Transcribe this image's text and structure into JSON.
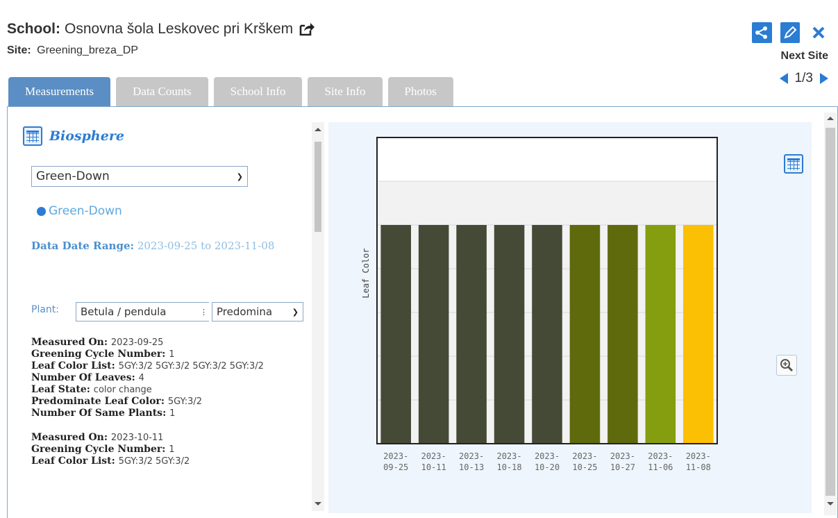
{
  "header": {
    "school_label": "School:",
    "school_name": "Osnovna šola Leskovec pri Krškem",
    "site_label": "Site:",
    "site_name": "Greening_breza_DP"
  },
  "nav": {
    "next_site": "Next Site",
    "page": "1/3"
  },
  "tabs": [
    {
      "label": "Measurements",
      "active": true
    },
    {
      "label": "Data Counts",
      "active": false
    },
    {
      "label": "School Info",
      "active": false
    },
    {
      "label": "Site Info",
      "active": false
    },
    {
      "label": "Photos",
      "active": false
    }
  ],
  "left": {
    "section_title": "Biosphere",
    "protocol_select": "Green-Down",
    "radio_label": "Green-Down",
    "date_range_label": "Data Date Range:",
    "date_range_value": "2023-09-25 to 2023-11-08",
    "plant_label": "Plant:",
    "plant_select": "Betula / pendula",
    "color_select": "Predomina"
  },
  "records": [
    {
      "measured_on_k": "Measured On",
      "measured_on_v": "2023-09-25",
      "cycle_k": "Greening Cycle Number",
      "cycle_v": "1",
      "list_k": "Leaf Color List",
      "list_v": "5GY:3/2 5GY:3/2 5GY:3/2 5GY:3/2",
      "leaves_k": "Number Of Leaves",
      "leaves_v": "4",
      "state_k": "Leaf State",
      "state_v": "color change",
      "pred_k": "Predominate Leaf Color",
      "pred_v": "5GY:3/2",
      "same_k": "Number Of Same Plants",
      "same_v": "1"
    },
    {
      "measured_on_k": "Measured On",
      "measured_on_v": "2023-10-11",
      "cycle_k": "Greening Cycle Number",
      "cycle_v": "1",
      "list_k": "Leaf Color List",
      "list_v": "5GY:3/2 5GY:3/2"
    }
  ],
  "colors": {
    "accent": "#2b7cd3",
    "tab_active": "#5b8ec4",
    "tab_inactive": "#c7c7c7"
  },
  "icons": {
    "external": "external-link-icon",
    "share": "share-icon",
    "edit": "edit-pencil-icon",
    "close": "close-x-icon",
    "table": "table-icon",
    "zoom": "zoom-in-icon"
  },
  "chart_data": {
    "type": "bar",
    "ylabel": "Leaf Color",
    "categories": [
      [
        "2023-",
        "09-25"
      ],
      [
        "2023-",
        "10-11"
      ],
      [
        "2023-",
        "10-13"
      ],
      [
        "2023-",
        "10-18"
      ],
      [
        "2023-",
        "10-20"
      ],
      [
        "2023-",
        "10-25"
      ],
      [
        "2023-",
        "10-27"
      ],
      [
        "2023-",
        "11-06"
      ],
      [
        "2023-",
        "11-08"
      ]
    ],
    "values": [
      1,
      1,
      1,
      1,
      1,
      1,
      1,
      1,
      1
    ],
    "colors": [
      "#454a36",
      "#454a36",
      "#454a36",
      "#454a36",
      "#454a36",
      "#5f6a0c",
      "#5f6a0c",
      "#859e0f",
      "#fbbf04"
    ],
    "ylim": [
      0,
      1.4
    ],
    "grid": true
  }
}
